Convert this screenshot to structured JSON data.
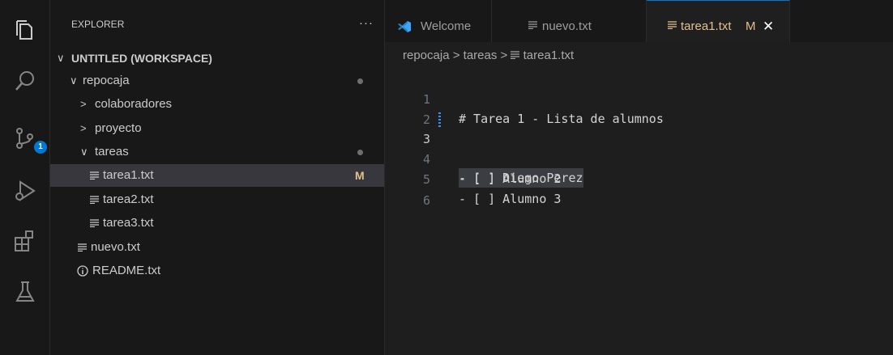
{
  "activity_bar": {
    "items": [
      {
        "name": "explorer-icon"
      },
      {
        "name": "search-icon"
      },
      {
        "name": "source-control-icon",
        "badge": "1"
      },
      {
        "name": "run-debug-icon"
      },
      {
        "name": "extensions-icon"
      },
      {
        "name": "testing-icon"
      }
    ]
  },
  "sidebar": {
    "title": "EXPLORER",
    "more": "···",
    "workspace": "UNTITLED (WORKSPACE)",
    "tree": [
      {
        "label": "repocaja",
        "type": "folder",
        "open": true,
        "dot": true
      },
      {
        "label": "colaboradores",
        "type": "folder",
        "open": false
      },
      {
        "label": "proyecto",
        "type": "folder",
        "open": false
      },
      {
        "label": "tareas",
        "type": "folder",
        "open": true,
        "dot": true
      },
      {
        "label": "tarea1.txt",
        "type": "file",
        "flag": "M",
        "selected": true
      },
      {
        "label": "tarea2.txt",
        "type": "file"
      },
      {
        "label": "tarea3.txt",
        "type": "file"
      },
      {
        "label": "nuevo.txt",
        "type": "file"
      },
      {
        "label": "README.txt",
        "type": "info"
      }
    ]
  },
  "tabs": [
    {
      "label": "Welcome",
      "icon": "vscode-logo-icon"
    },
    {
      "label": "nuevo.txt",
      "icon": "text-file-icon"
    },
    {
      "label": "tarea1.txt",
      "flag": "M",
      "icon": "text-file-icon",
      "active": true
    }
  ],
  "breadcrumb": {
    "parts": [
      "repocaja",
      "tareas",
      "tarea1.txt"
    ],
    "sep": ">"
  },
  "editor": {
    "lines": [
      {
        "num": "1",
        "text": "# Tarea 1 - Lista de alumnos"
      },
      {
        "num": "2",
        "text": ""
      },
      {
        "num": "3",
        "text": "- [ ] Diego Perez"
      },
      {
        "num": "4",
        "text": "- [ ] Alumno 2"
      },
      {
        "num": "5",
        "text": "- [ ] Alumno 3"
      },
      {
        "num": "6",
        "text": ""
      }
    ]
  },
  "colors": {
    "accent": "#0078d4",
    "modified": "#e2c08d"
  }
}
